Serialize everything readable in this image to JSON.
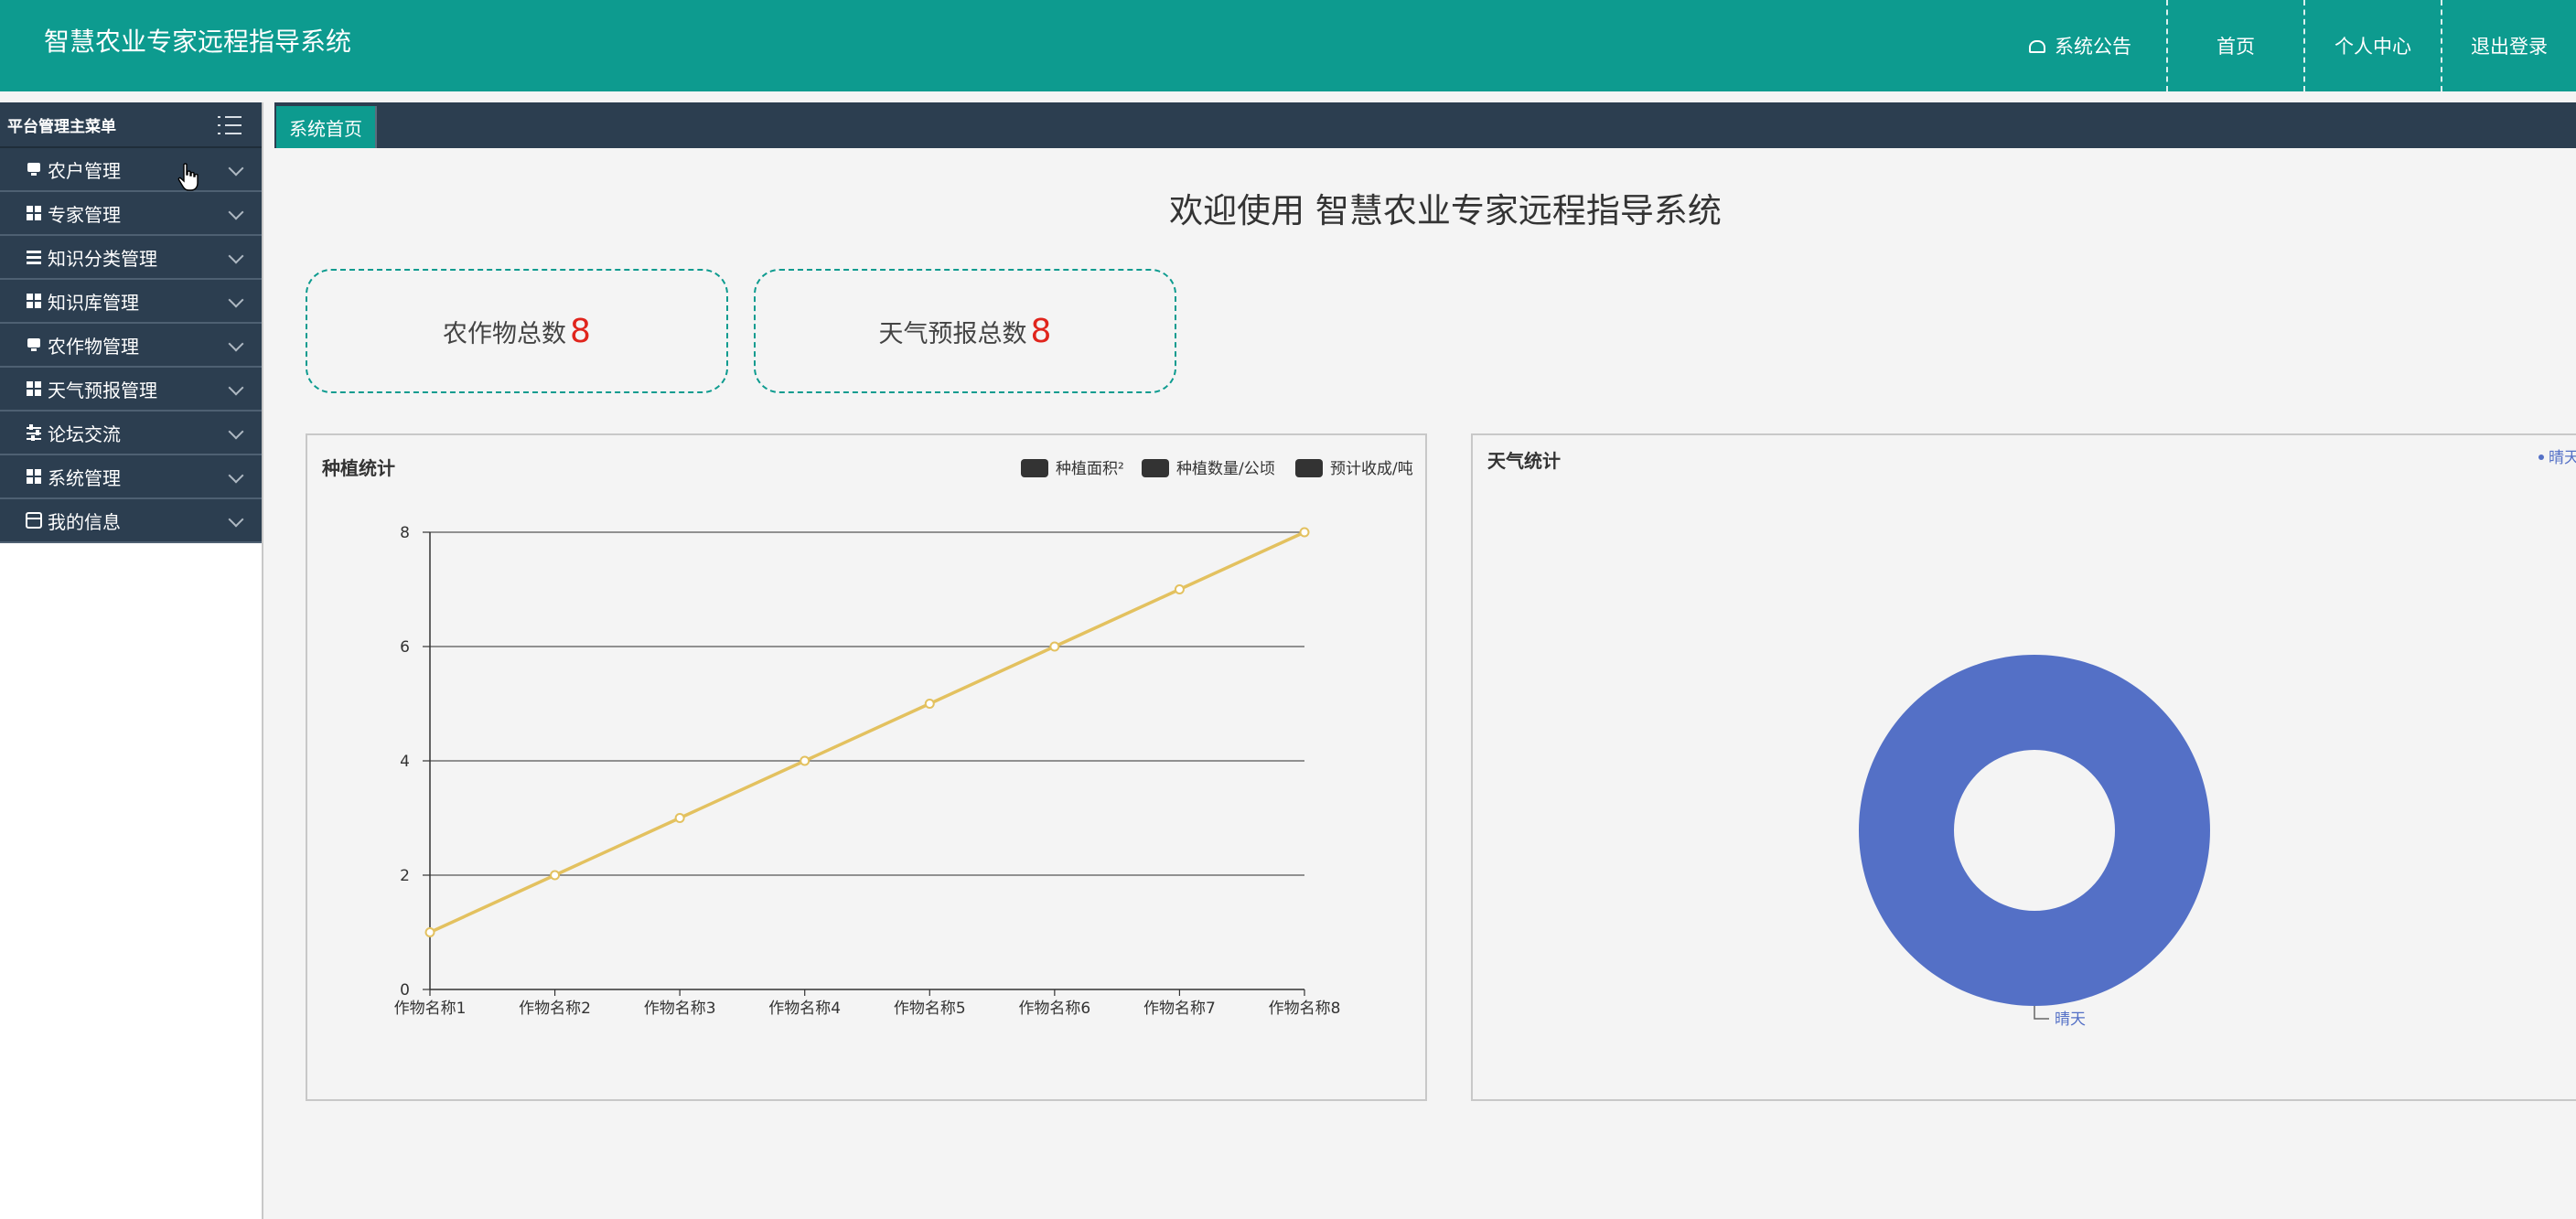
{
  "header": {
    "app_title": "智慧农业专家远程指导系统",
    "nav": {
      "notice": "系统公告",
      "home": "首页",
      "profile": "个人中心",
      "logout": "退出登录"
    }
  },
  "sidebar": {
    "title": "平台管理主菜单",
    "items": [
      {
        "label": "农户管理",
        "icon": "monitor-icon"
      },
      {
        "label": "专家管理",
        "icon": "grid-icon"
      },
      {
        "label": "知识分类管理",
        "icon": "list-icon"
      },
      {
        "label": "知识库管理",
        "icon": "grid-icon"
      },
      {
        "label": "农作物管理",
        "icon": "monitor-icon"
      },
      {
        "label": "天气预报管理",
        "icon": "grid-icon"
      },
      {
        "label": "论坛交流",
        "icon": "sliders-icon"
      },
      {
        "label": "系统管理",
        "icon": "grid-icon"
      },
      {
        "label": "我的信息",
        "icon": "card-icon"
      }
    ]
  },
  "tabs": [
    {
      "label": "系统首页",
      "active": true
    }
  ],
  "main": {
    "welcome": "欢迎使用 智慧农业专家远程指导系统",
    "stats": [
      {
        "label": "农作物总数",
        "value": "8"
      },
      {
        "label": "天气预报总数",
        "value": "8"
      }
    ]
  },
  "colors": {
    "primary": "#0d9b8f",
    "sidebar": "#2c3e50",
    "stat_value": "#e0241c",
    "line_series": "#e3c15f",
    "pie": "#5470c6"
  },
  "chart_data": [
    {
      "type": "line",
      "title": "种植统计",
      "categories": [
        "作物名称1",
        "作物名称2",
        "作物名称3",
        "作物名称4",
        "作物名称5",
        "作物名称6",
        "作物名称7",
        "作物名称8"
      ],
      "legend": [
        "种植面积²",
        "种植数量/公顷",
        "预计收成/吨"
      ],
      "legend_position": "top-right",
      "series": [
        {
          "name": "预计收成/吨",
          "values": [
            1,
            2,
            3,
            4,
            5,
            6,
            7,
            8
          ]
        }
      ],
      "ylim": [
        0,
        8
      ],
      "yticks": [
        0,
        2,
        4,
        6,
        8
      ],
      "grid": true
    },
    {
      "type": "pie",
      "title": "天气统计",
      "legend": [
        "晴天"
      ],
      "legend_position": "top-right",
      "slices": [
        {
          "name": "晴天",
          "value": 8
        }
      ],
      "donut": true
    }
  ]
}
